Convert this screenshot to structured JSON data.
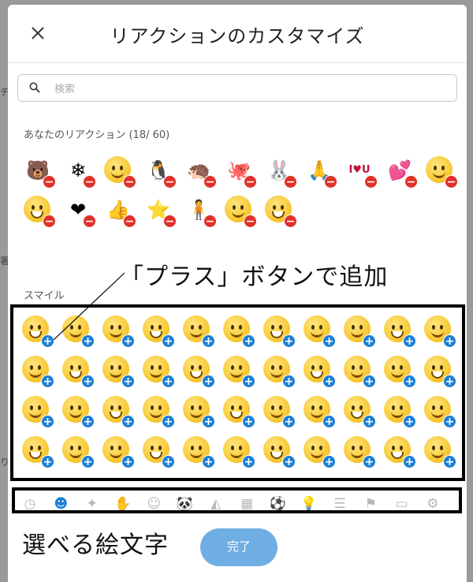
{
  "header": {
    "title": "リアクションのカスタマイズ",
    "close_icon": "close-icon"
  },
  "search": {
    "placeholder": "検索",
    "value": ""
  },
  "your_reactions": {
    "label": "あなたのリアクション (18/ 60)",
    "items": [
      {
        "name": "bear",
        "glyph": "🐻"
      },
      {
        "name": "snowflake",
        "glyph": "❄"
      },
      {
        "name": "blush-face",
        "glyph": ""
      },
      {
        "name": "penguin",
        "glyph": "🐧"
      },
      {
        "name": "hedgehog",
        "glyph": "🦔"
      },
      {
        "name": "octopus",
        "glyph": "🐙"
      },
      {
        "name": "rabbit",
        "glyph": "🐰"
      },
      {
        "name": "praying-hands",
        "glyph": "🙏"
      },
      {
        "name": "i-love-u",
        "glyph": "I♥U"
      },
      {
        "name": "hearts",
        "glyph": "💕"
      },
      {
        "name": "worried-face",
        "glyph": ""
      },
      {
        "name": "surprised-face",
        "glyph": ""
      },
      {
        "name": "heart",
        "glyph": "❤"
      },
      {
        "name": "thumbs-up",
        "glyph": "👍"
      },
      {
        "name": "star",
        "glyph": "⭐"
      },
      {
        "name": "person",
        "glyph": "🧍"
      },
      {
        "name": "party-face",
        "glyph": ""
      },
      {
        "name": "sleepy-face",
        "glyph": ""
      }
    ]
  },
  "smileys": {
    "label": "スマイル",
    "count": 44
  },
  "annotation_plus": "「プラス」ボタンで追加",
  "annotation_emoji": "選べる絵文字",
  "categories": [
    {
      "name": "recent",
      "glyph": "◷"
    },
    {
      "name": "smileys",
      "glyph": "☻",
      "active": true
    },
    {
      "name": "animated",
      "glyph": "✦"
    },
    {
      "name": "hand",
      "glyph": "✋"
    },
    {
      "name": "people",
      "glyph": "☺"
    },
    {
      "name": "animals",
      "glyph": "🐼"
    },
    {
      "name": "food",
      "glyph": "◭"
    },
    {
      "name": "buildings",
      "glyph": "▦"
    },
    {
      "name": "sports",
      "glyph": "⚽"
    },
    {
      "name": "objects",
      "glyph": "💡"
    },
    {
      "name": "symbols",
      "glyph": "☰"
    },
    {
      "name": "flags",
      "glyph": "⚑"
    },
    {
      "name": "video",
      "glyph": "▭"
    },
    {
      "name": "settings",
      "glyph": "⚙"
    }
  ],
  "done_label": "完了",
  "colors": {
    "accent": "#1c7fd6",
    "remove": "#e0322a",
    "done_bg": "#6faee3"
  }
}
